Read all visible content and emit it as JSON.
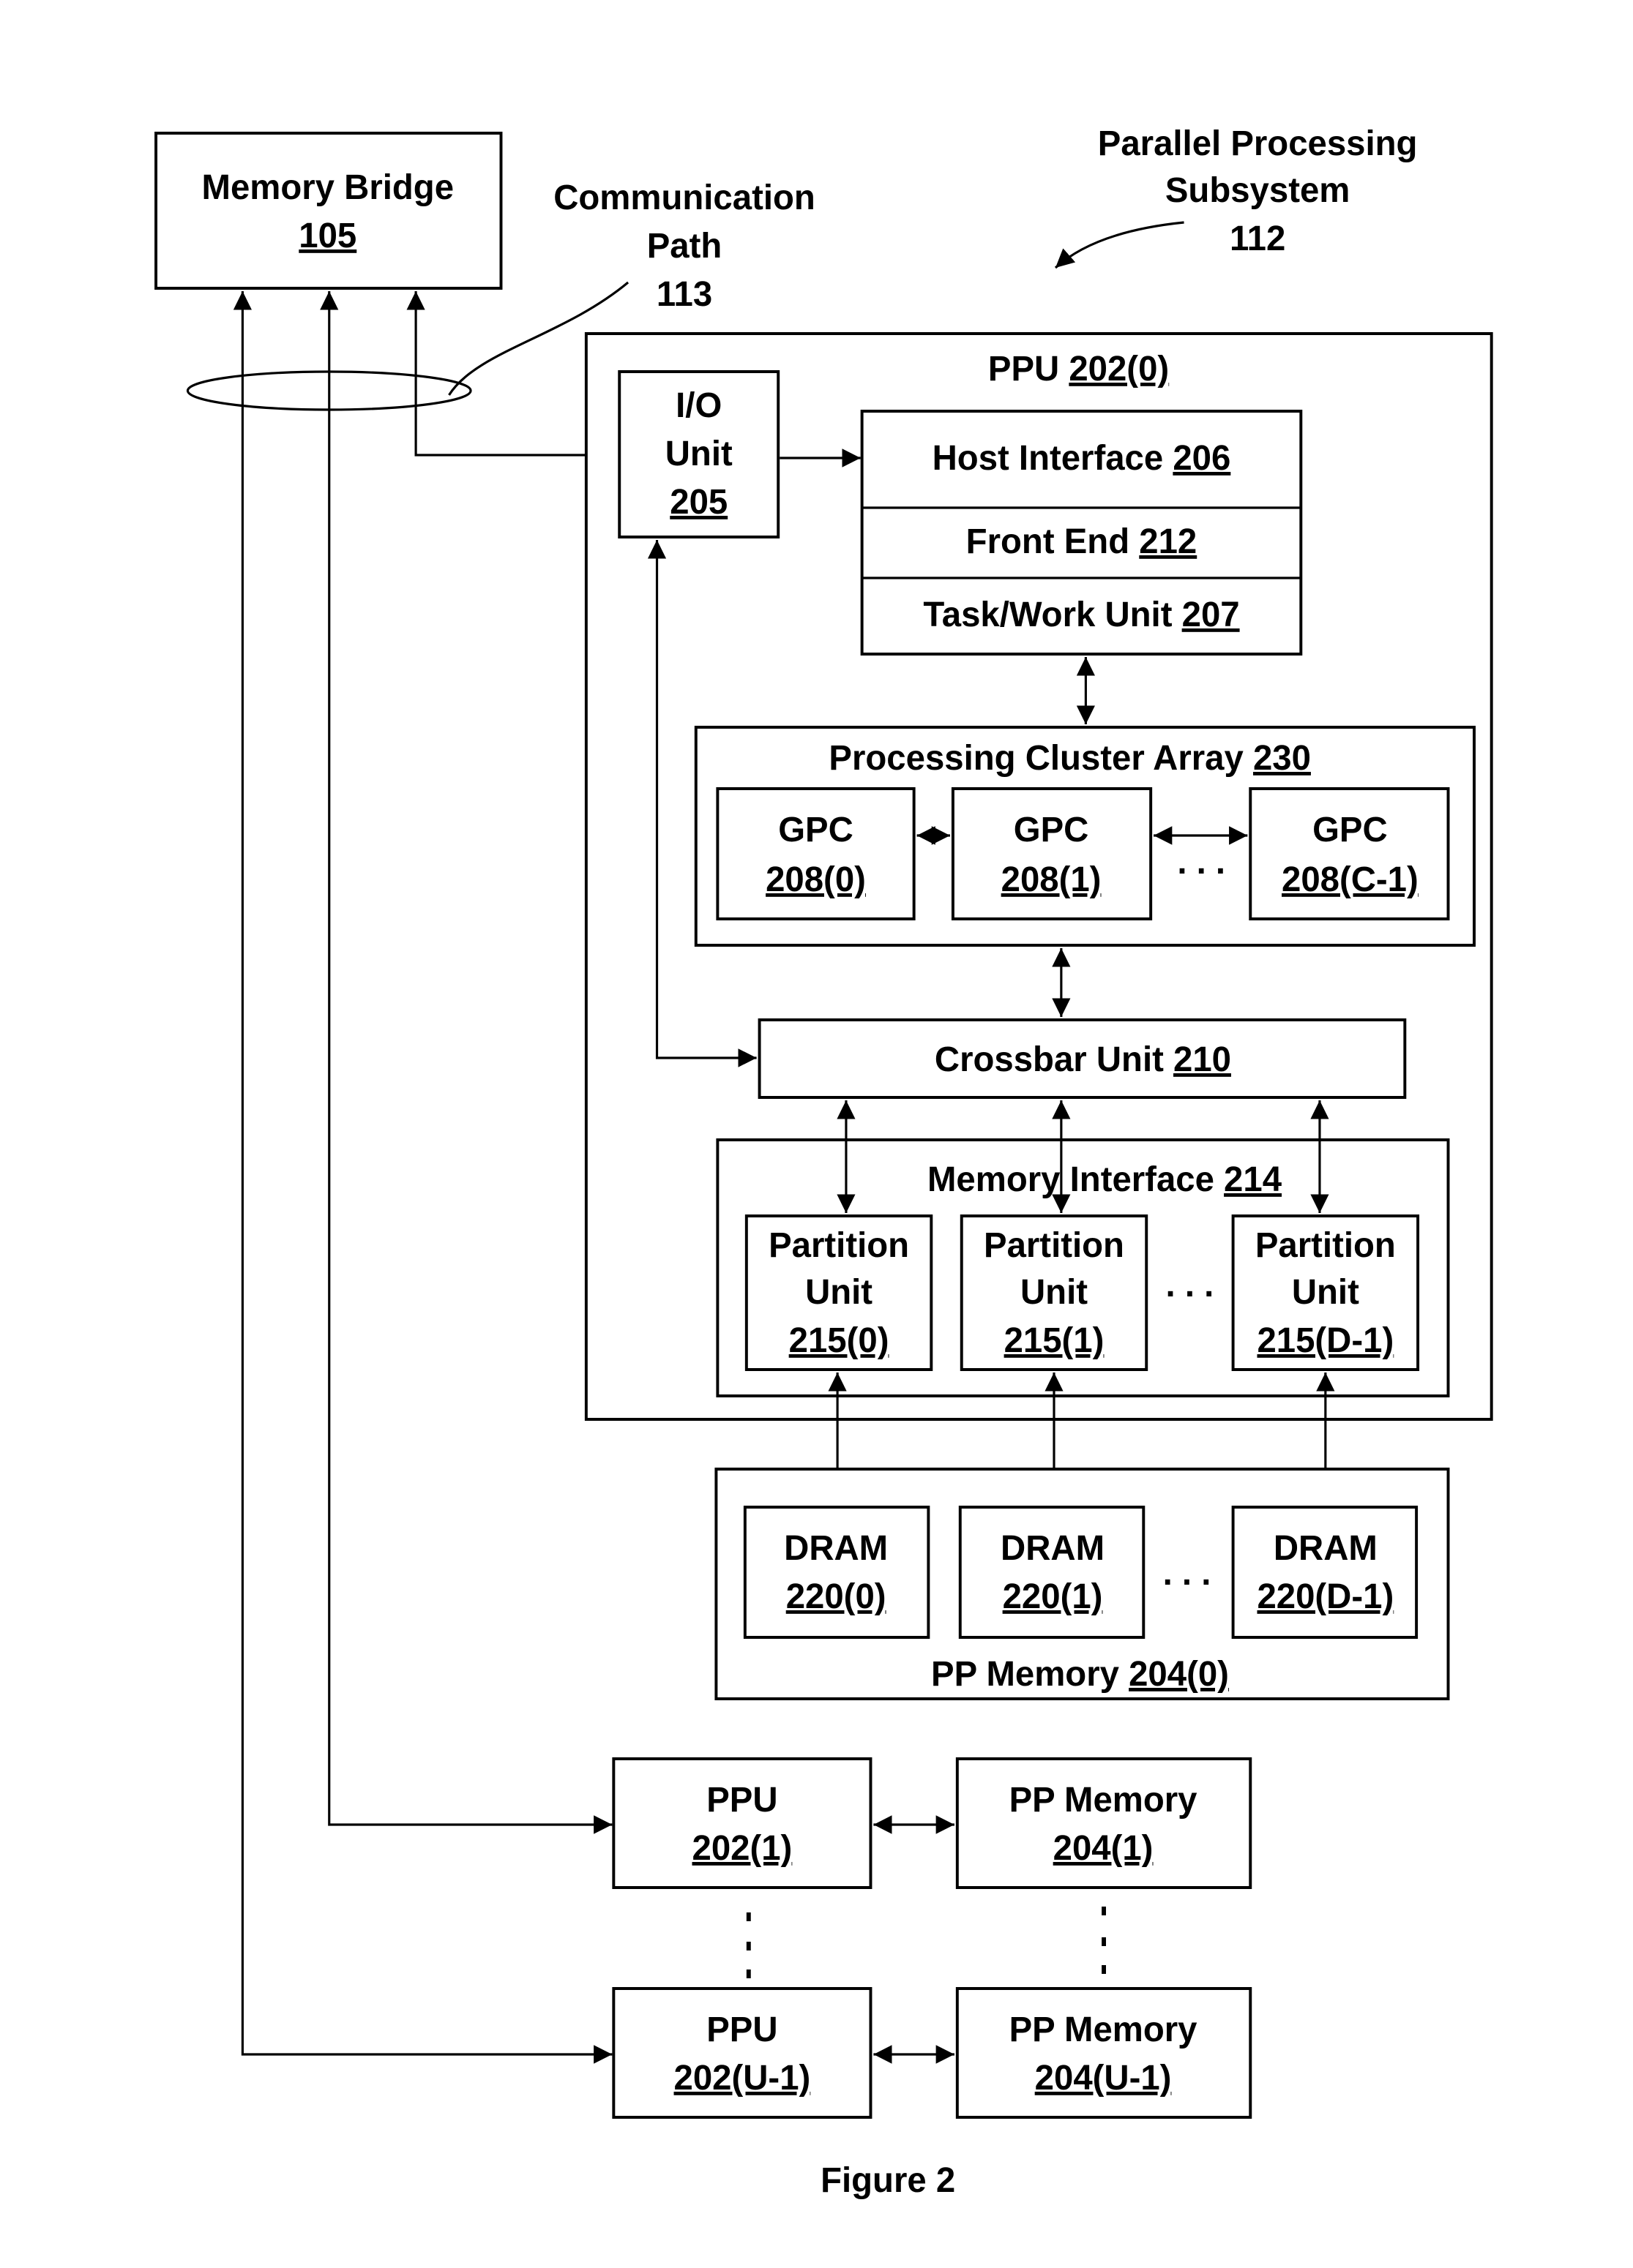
{
  "figure": {
    "caption": "Figure 2",
    "colors": {
      "ink": "#000000",
      "background": "#ffffff"
    }
  },
  "labels": {
    "pps_line1": "Parallel Processing",
    "pps_line2": "Subsystem",
    "pps_ref": "112",
    "comm_line1": "Communication",
    "comm_line2": "Path",
    "comm_ref": "113"
  },
  "memory_bridge": {
    "name": "Memory Bridge",
    "ref": "105"
  },
  "ppu0": {
    "name": "PPU ",
    "ref": "202(0)"
  },
  "io_unit": {
    "line1": "I/O",
    "line2": "Unit",
    "ref": "205"
  },
  "host_interface": {
    "name": "Host Interface ",
    "ref": "206"
  },
  "front_end": {
    "name": "Front End ",
    "ref": "212"
  },
  "task_work_unit": {
    "name": "Task/Work Unit ",
    "ref": "207"
  },
  "processing_cluster_array": {
    "name": "Processing Cluster Array ",
    "ref": "230",
    "gpcs": [
      {
        "name": "GPC",
        "ref": "208(0)"
      },
      {
        "name": "GPC",
        "ref": "208(1)"
      },
      {
        "name": "GPC",
        "ref": "208(C-1)"
      }
    ],
    "ellipsis": ". . ."
  },
  "crossbar": {
    "name": "Crossbar Unit ",
    "ref": "210"
  },
  "memory_interface": {
    "name": "Memory Interface ",
    "ref": "214",
    "partitions": [
      {
        "line1": "Partition",
        "line2": "Unit",
        "ref": "215(0)"
      },
      {
        "line1": "Partition",
        "line2": "Unit",
        "ref": "215(1)"
      },
      {
        "line1": "Partition",
        "line2": "Unit",
        "ref": "215(D-1)"
      }
    ],
    "ellipsis": ". . ."
  },
  "pp_memory0": {
    "name": "PP Memory ",
    "ref": "204(0)",
    "drams": [
      {
        "name": "DRAM",
        "ref": "220(0)"
      },
      {
        "name": "DRAM",
        "ref": "220(1)"
      },
      {
        "name": "DRAM",
        "ref": "220(D-1)"
      }
    ],
    "ellipsis": ". . ."
  },
  "ppu_others": [
    {
      "name": "PPU",
      "ref": "202(1)",
      "mem_name": "PP Memory",
      "mem_ref": "204(1)"
    },
    {
      "name": "PPU",
      "ref": "202(U-1)",
      "mem_name": "PP Memory",
      "mem_ref": "204(U-1)"
    }
  ]
}
